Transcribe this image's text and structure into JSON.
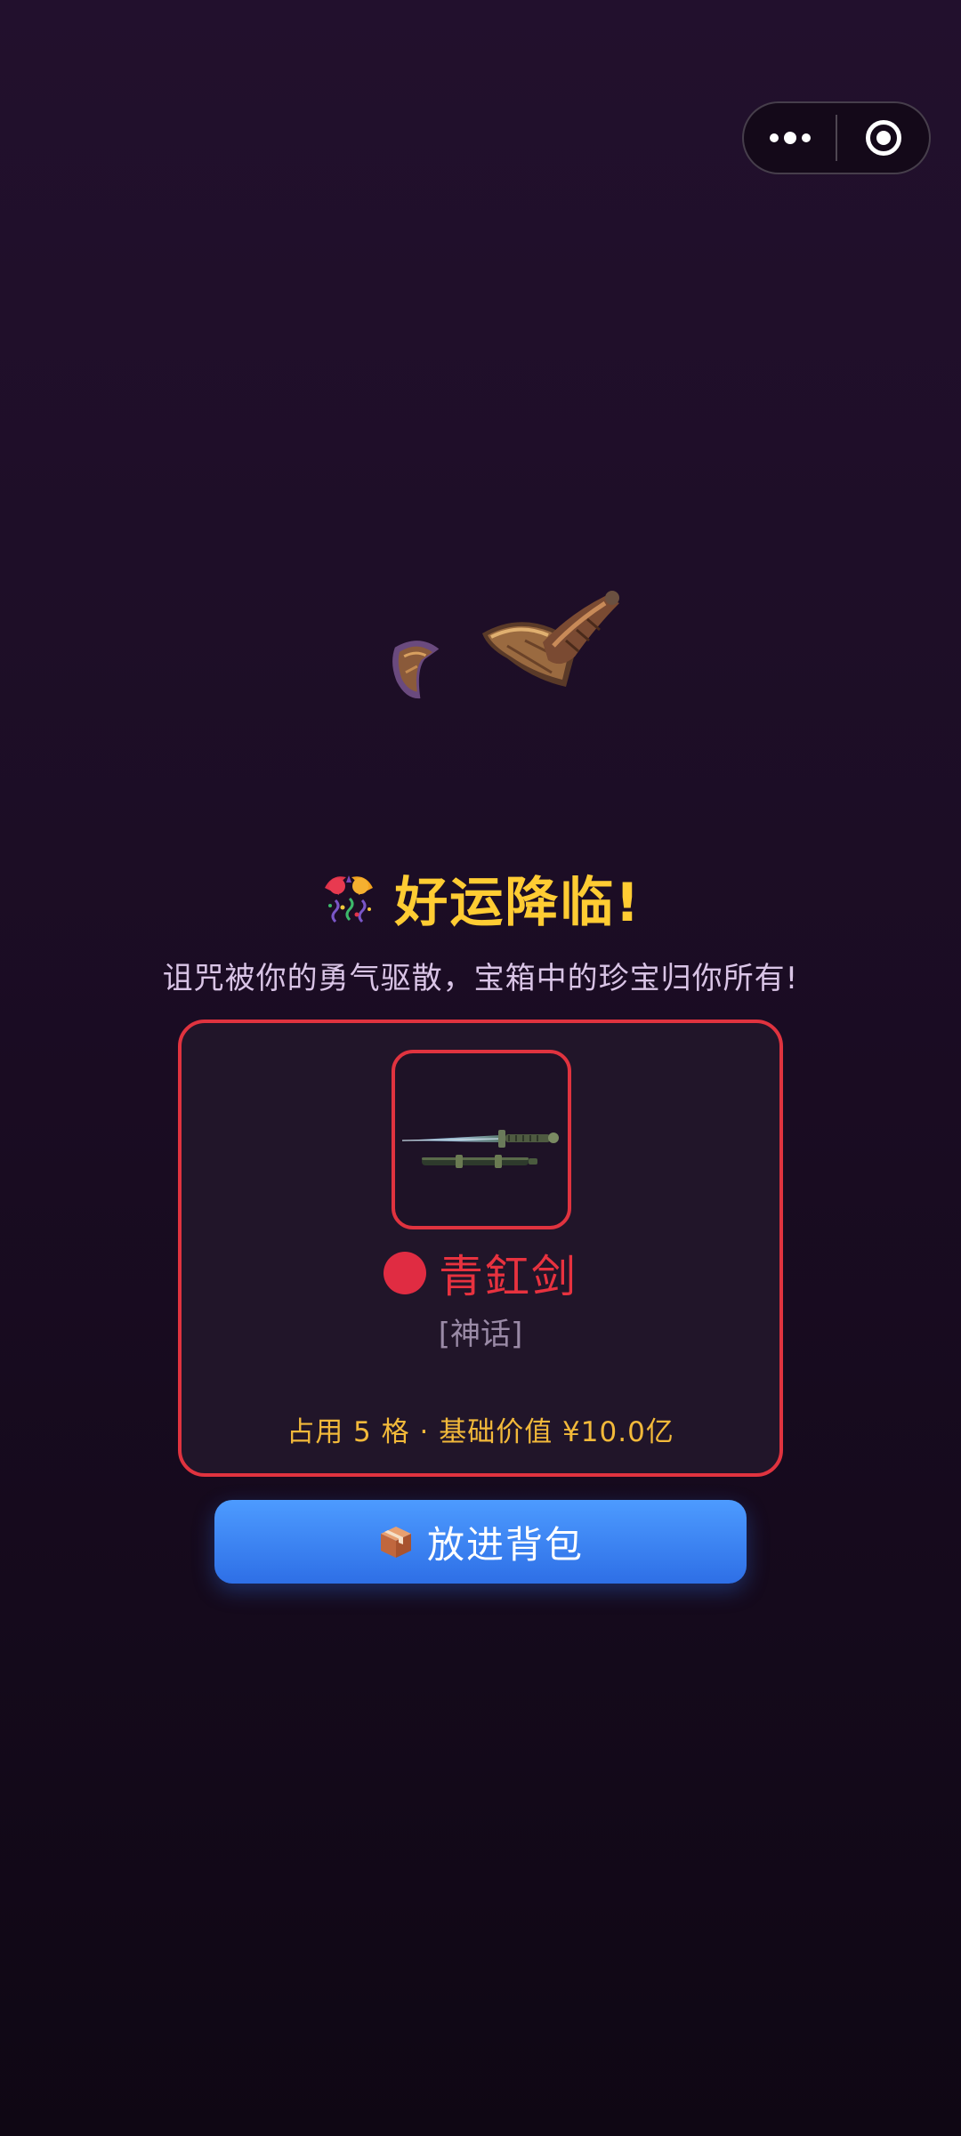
{
  "capsule": {
    "more_icon": "more-dots-icon",
    "close_icon": "target-circle-icon"
  },
  "illustration": {
    "icon": "opened-chest-pieces-icon"
  },
  "result": {
    "title_icon": "confetti-icon",
    "title": "好运降临!",
    "subtitle": "诅咒被你的勇气驱散，宝箱中的珍宝归你所有!"
  },
  "reward": {
    "item_icon": "sword-icon",
    "rarity_color": "#e02c42",
    "name": "青釭剑",
    "rarity_label": "[神话]",
    "stats": "占用 5 格 · 基础价值 ¥10.0亿"
  },
  "action": {
    "icon": "package-icon",
    "label": "放进背包"
  },
  "colors": {
    "accent_gold": "#ffcc33",
    "card_border": "#e0333f",
    "button_blue": "#3f86f5"
  }
}
